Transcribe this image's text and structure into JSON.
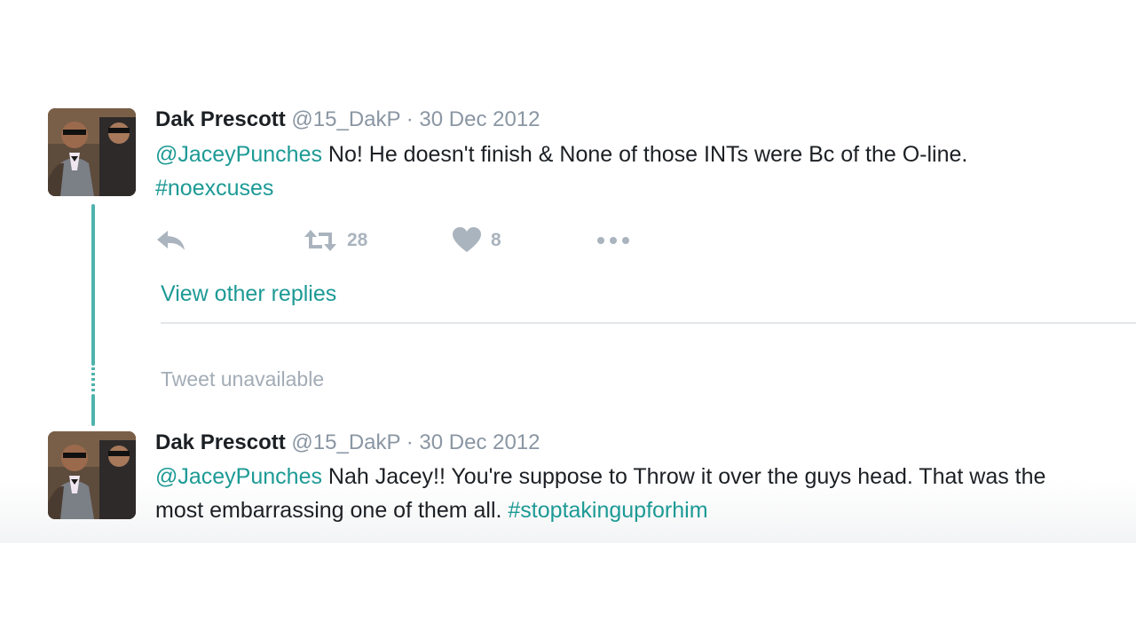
{
  "tweets": [
    {
      "name": "Dak Prescott",
      "handle": "@15_DakP",
      "separator": " · ",
      "date": "30 Dec 2012",
      "mention": "@JaceyPunches",
      "text": " No! He doesn't finish & None of those INTs were Bc of the O-line. ",
      "hashtag": "#noexcuses"
    },
    {
      "name": "Dak Prescott",
      "handle": "@15_DakP",
      "separator": " · ",
      "date": "30 Dec 2012",
      "mention": "@JaceyPunches",
      "text": " Nah Jacey!! You're suppose to Throw it over the guys head. That was the most embarrassing one of them all. ",
      "hashtag": "#stoptakingupforhim"
    }
  ],
  "actions": {
    "reply_icon": "reply-icon",
    "retweet_icon": "retweet-icon",
    "retweet_count": "28",
    "like_icon": "heart-icon",
    "like_count": "8",
    "more_icon": "more-icon"
  },
  "view_other_replies": "View other replies",
  "tweet_unavailable": "Tweet unavailable",
  "colors": {
    "link": "#1d9a95",
    "thread_line": "#4fb3ac",
    "muted": "#8a96a3"
  }
}
